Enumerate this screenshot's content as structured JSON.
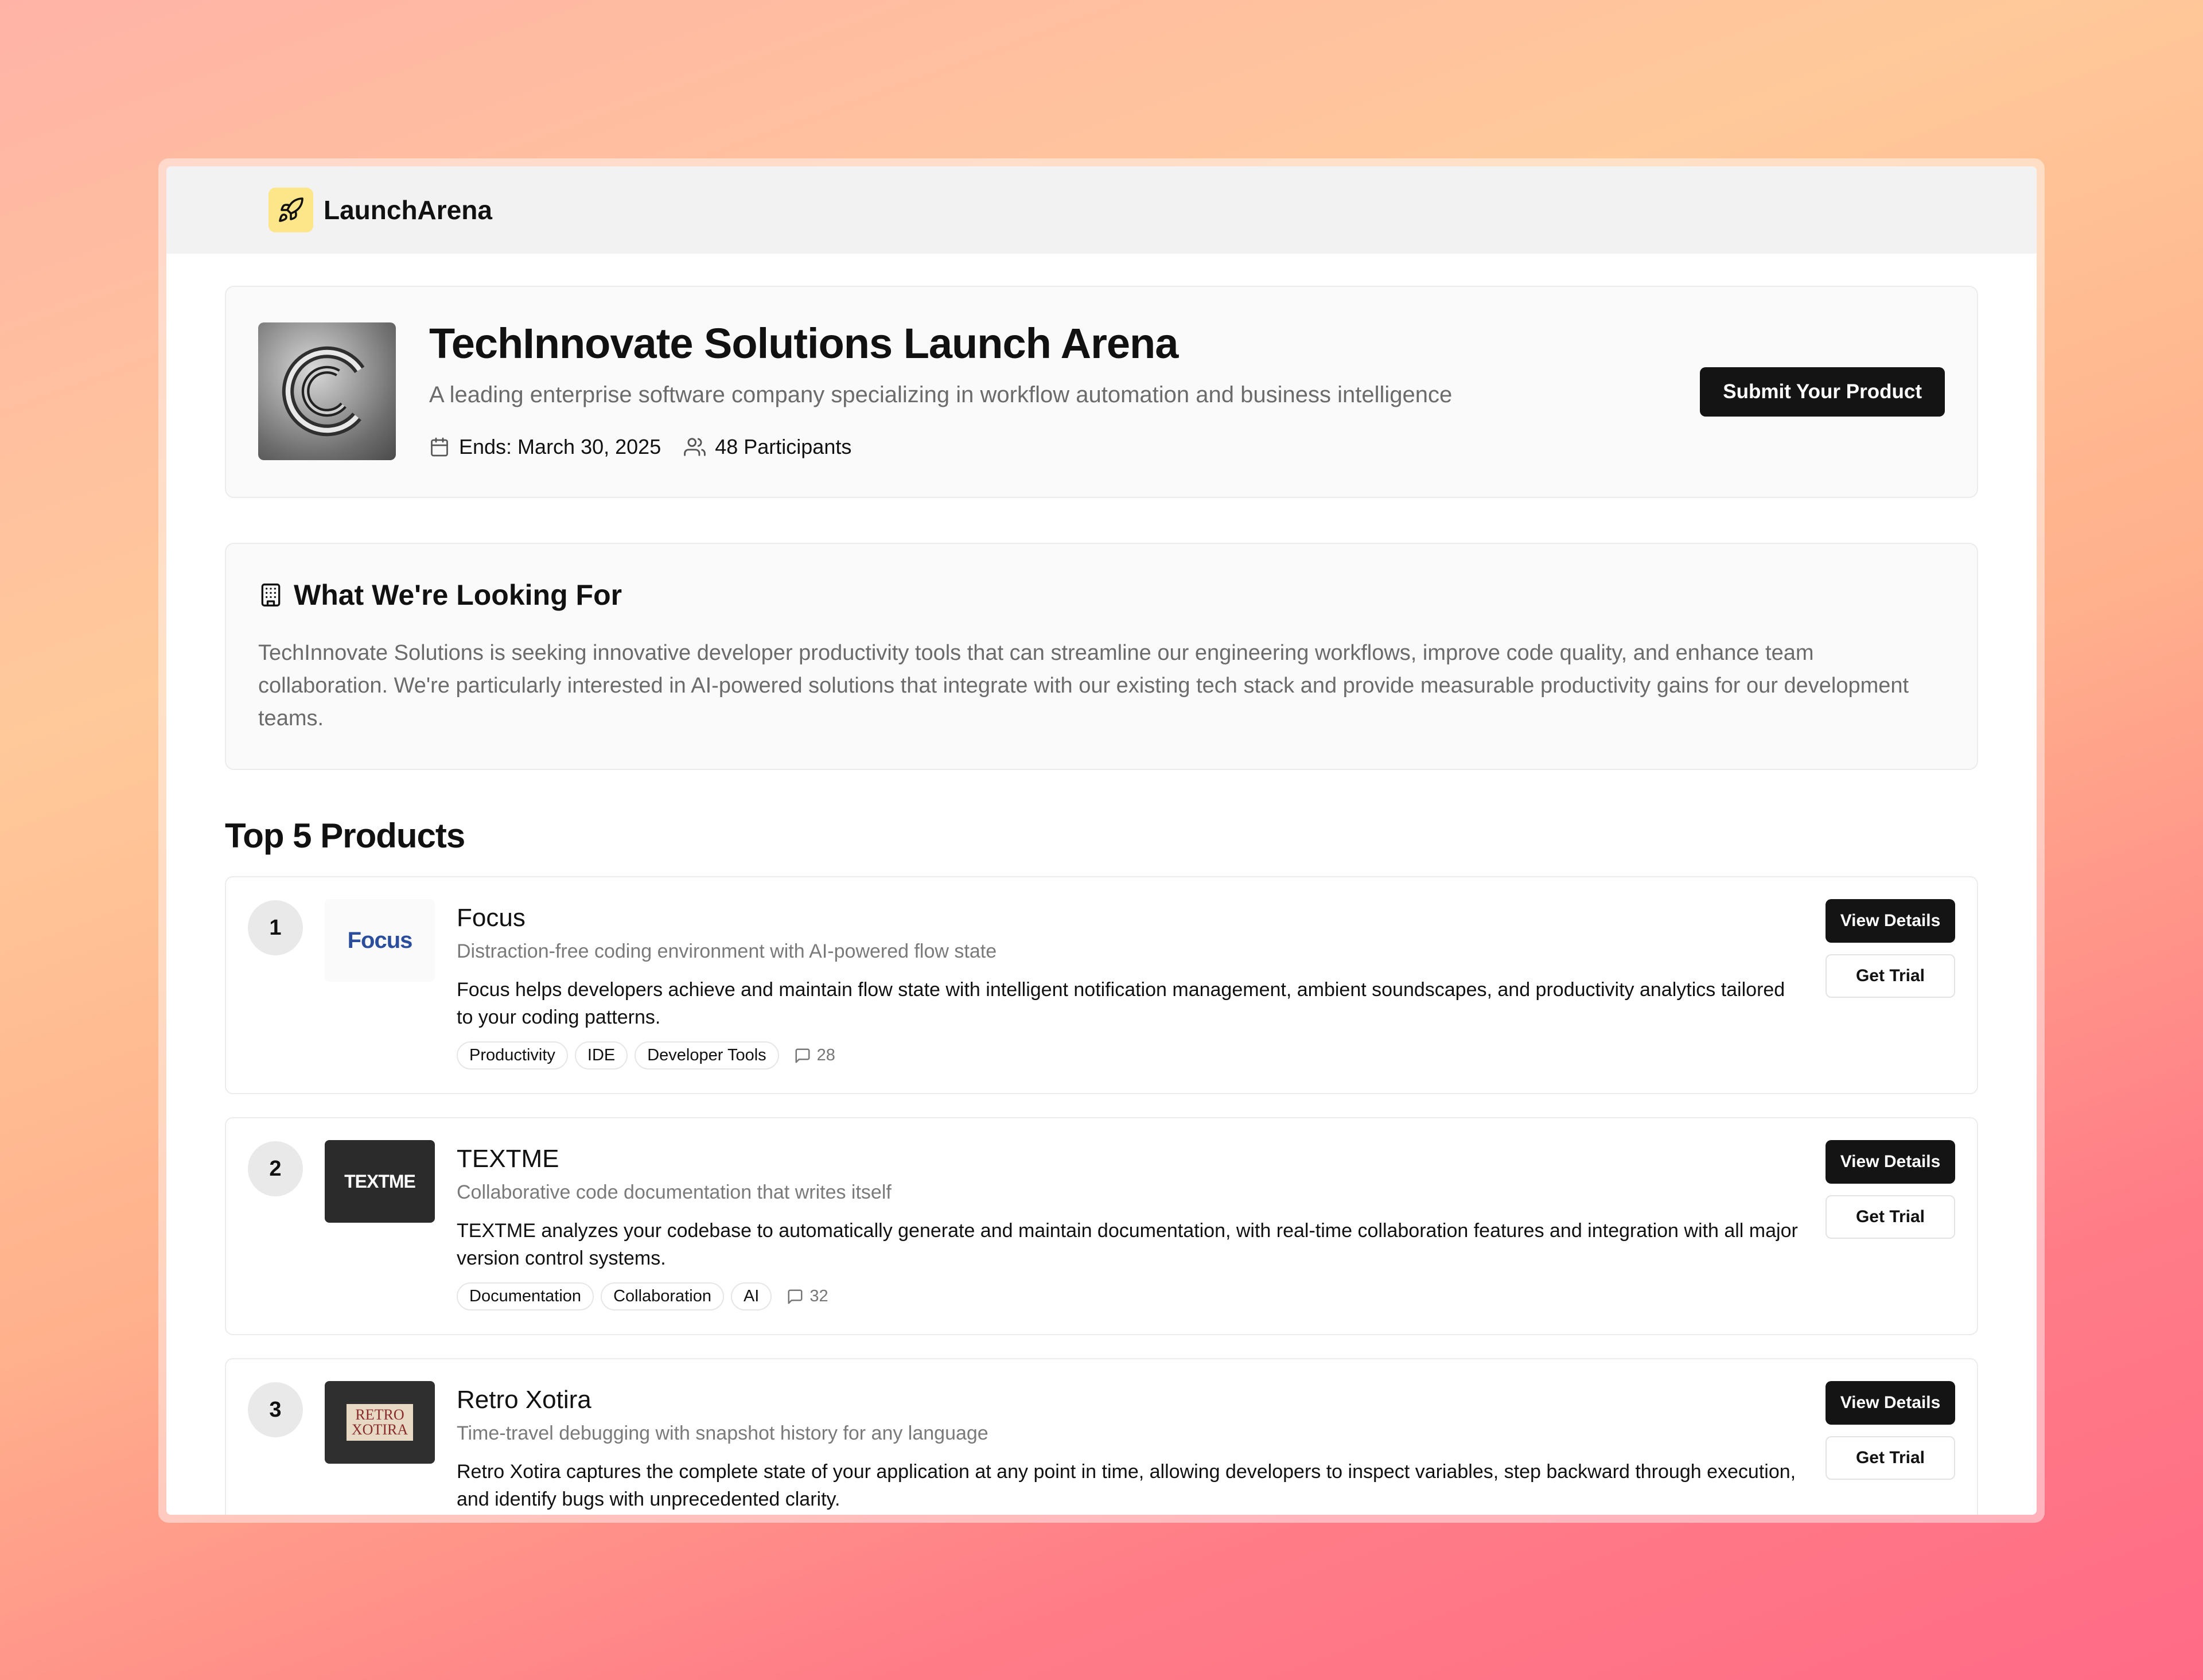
{
  "app": {
    "name": "LaunchArena"
  },
  "hero": {
    "title": "TechInnovate Solutions Launch Arena",
    "subtitle": "A leading enterprise software company specializing in workflow automation and business intelligence",
    "ends": "Ends: March 30, 2025",
    "participants": "48 Participants",
    "submit_label": "Submit Your Product"
  },
  "looking": {
    "title": "What We're Looking For",
    "body": "TechInnovate Solutions is seeking innovative developer productivity tools that can streamline our engineering workflows, improve code quality, and enhance team collaboration. We're particularly interested in AI-powered solutions that integrate with our existing tech stack and provide measurable productivity gains for our development teams."
  },
  "products_section": {
    "title": "Top 5 Products"
  },
  "products": [
    {
      "rank": "1",
      "name": "Focus",
      "logo_text": "Focus",
      "tagline": "Distraction-free coding environment with AI-powered flow state",
      "description": "Focus helps developers achieve and maintain flow state with intelligent notification management, ambient soundscapes, and productivity analytics tailored to your coding patterns.",
      "tags": [
        "Productivity",
        "IDE",
        "Developer Tools"
      ],
      "comments": "28",
      "view_label": "View Details",
      "trial_label": "Get Trial"
    },
    {
      "rank": "2",
      "name": "TEXTME",
      "logo_text": "TEXTME",
      "tagline": "Collaborative code documentation that writes itself",
      "description": "TEXTME analyzes your codebase to automatically generate and maintain documentation, with real-time collaboration features and integration with all major version control systems.",
      "tags": [
        "Documentation",
        "Collaboration",
        "AI"
      ],
      "comments": "32",
      "view_label": "View Details",
      "trial_label": "Get Trial"
    },
    {
      "rank": "3",
      "name": "Retro Xotira",
      "logo_text": "RETRO XOTIRA",
      "tagline": "Time-travel debugging with snapshot history for any language",
      "description": "Retro Xotira captures the complete state of your application at any point in time, allowing developers to inspect variables, step backward through execution, and identify bugs with unprecedented clarity.",
      "tags": [],
      "comments": "",
      "view_label": "View Details",
      "trial_label": "Get Trial"
    }
  ]
}
